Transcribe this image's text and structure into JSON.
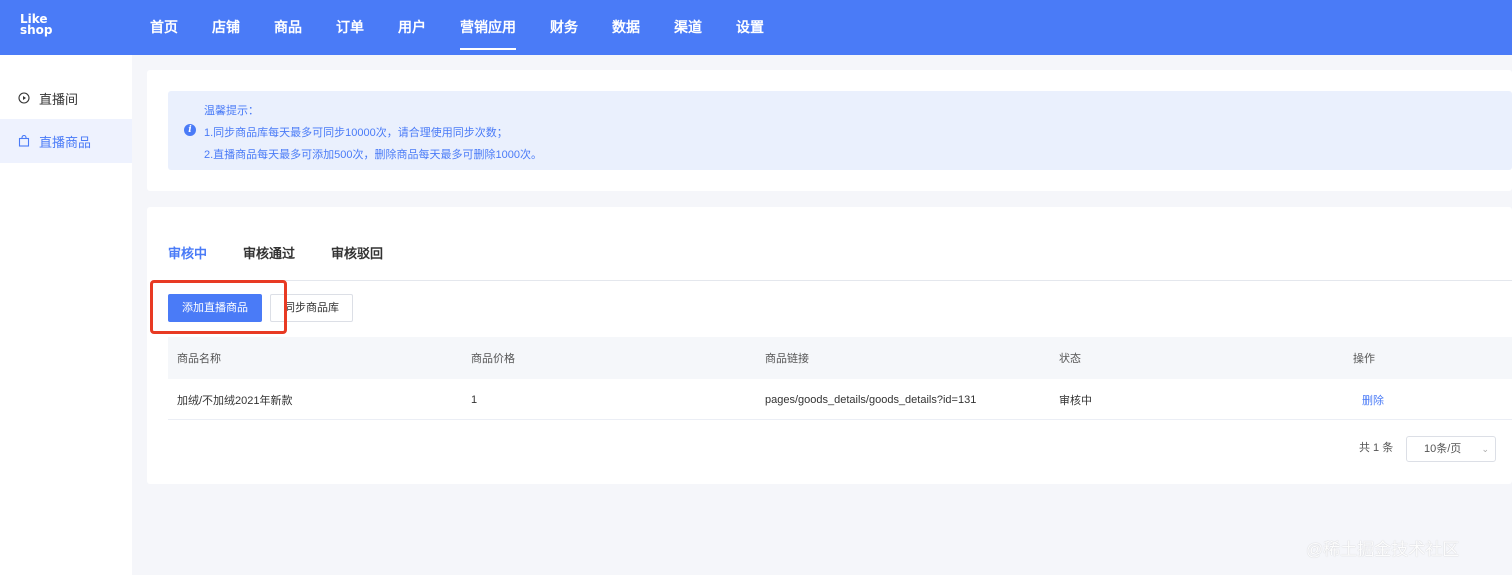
{
  "logo": {
    "line1": "Like",
    "line2": "shop"
  },
  "nav": [
    "首页",
    "店铺",
    "商品",
    "订单",
    "用户",
    "营销应用",
    "财务",
    "数据",
    "渠道",
    "设置"
  ],
  "nav_active": "营销应用",
  "sidebar": [
    {
      "label": "直播间",
      "icon": "play-circle-icon"
    },
    {
      "label": "直播商品",
      "icon": "shopping-bag-icon",
      "active": true
    }
  ],
  "notice": {
    "title": "温馨提示：",
    "line1": "1.同步商品库每天最多可同步10000次，请合理使用同步次数；",
    "line2": "2.直播商品每天最多可添加500次，删除商品每天最多可删除1000次。"
  },
  "tabs": [
    "审核中",
    "审核通过",
    "审核驳回"
  ],
  "tab_active": "审核中",
  "buttons": {
    "add": "添加直播商品",
    "sync": "同步商品库"
  },
  "table": {
    "headers": [
      "商品名称",
      "商品价格",
      "商品链接",
      "状态",
      "操作"
    ],
    "rows": [
      {
        "name": "加绒/不加绒2021年新款",
        "price": "1",
        "link": "pages/goods_details/goods_details?id=131",
        "status": "审核中",
        "action": "删除"
      }
    ]
  },
  "pagination": {
    "total": "共 1 条",
    "page_size": "10条/页"
  },
  "watermark": "@稀土掘金技术社区",
  "colors": {
    "primary": "#4a7bf7",
    "highlight": "#e83a23"
  }
}
